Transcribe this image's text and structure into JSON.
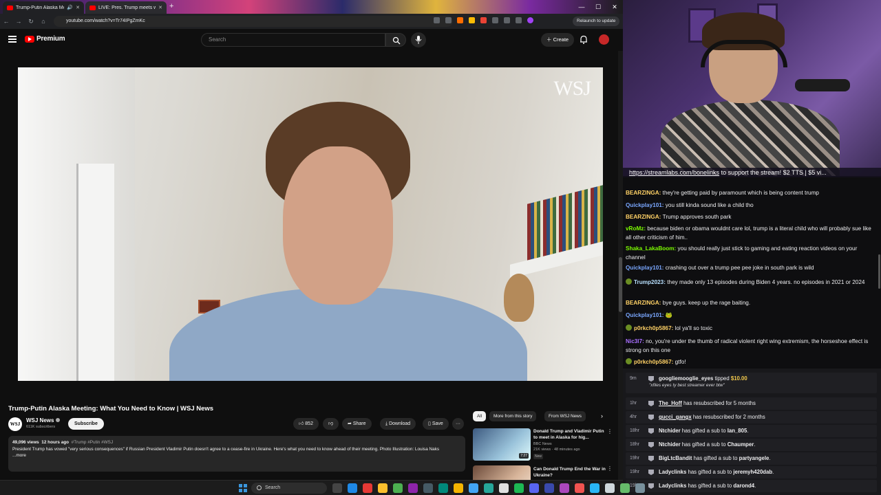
{
  "browser": {
    "tabs": [
      {
        "title": "Trump-Putin Alaska Meetin",
        "active": true
      },
      {
        "title": "LIVE: Pres. Trump meets with P",
        "active": false
      }
    ],
    "url": "youtube.com/watch?v=Tr74IPgZmKc",
    "relaunch_label": "Relaunch to update"
  },
  "youtube": {
    "logo_text": "Premium",
    "search_placeholder": "Search",
    "create_label": "Create",
    "video": {
      "watermark": "WSJ",
      "title": "Trump-Putin Alaska Meeting: What You Need to Know | WSJ News",
      "channel": "WSJ News",
      "channel_avatar_text": "WSJ",
      "subscribers": "611K subscribers",
      "subscribe_label": "Subscribe",
      "likes": "852",
      "share_label": "Share",
      "download_label": "Download",
      "save_label": "Save",
      "more_label": "···",
      "views": "49,096 views",
      "age": "12 hours ago",
      "hashtags": "#Trump #Putin #WSJ",
      "description": "President Trump has vowed \"very serious consequences\" if Russian President Vladimir Putin doesn't agree to a cease-fire in Ukraine. Here's what you need to know ahead of their meeting. Photo Illustration: Louisa Naks",
      "more_link": "...more"
    },
    "chips": [
      "All",
      "More from this story",
      "From WSJ News"
    ],
    "recommendations": [
      {
        "title": "Donald Trump and Vladimir Putin to meet in Alaska for hig...",
        "channel": "BBC News",
        "meta": "21K views · 48 minutes ago",
        "badge": "New",
        "duration": "7:27"
      },
      {
        "title": "Can Donald Trump End the War in Ukraine?",
        "channel": "",
        "meta": "",
        "badge": "",
        "duration": ""
      }
    ]
  },
  "stream": {
    "ticker_link": "https://streamlabs.com/bonelinks",
    "ticker_text": " to support the stream! $2 TTS | $5 vi...",
    "chat": [
      {
        "user": "BEARZINGA",
        "color": "#ffd166",
        "text": "they're getting paid by paramount which is being content trump",
        "badge": false
      },
      {
        "user": "Quickplay101",
        "color": "#7aa7ff",
        "text": "you still kinda sound like a child tho",
        "badge": false
      },
      {
        "user": "BEARZINGA",
        "color": "#ffd166",
        "text": "Trump approves south park",
        "badge": false
      },
      {
        "user": "vRoMz",
        "color": "#7cfc00",
        "text": "because biden or obama wouldnt care lol, trump is a literal child who will probably sue like all other criticism of him..",
        "badge": false
      },
      {
        "user": "Shaka_LakaBoom",
        "color": "#7cfc00",
        "text": "you should really just stick to gaming and eating reaction videos on your channel",
        "badge": false
      },
      {
        "user": "Quickplay101",
        "color": "#7aa7ff",
        "text": "crashing out over a trump pee pee joke in south park is wild",
        "badge": false
      },
      {
        "user": "Trump2023",
        "color": "#b8e0ff",
        "text": "they made only 13 episodes during Biden 4 years. no episodes in 2021 or 2024",
        "badge": true
      },
      {
        "user": "BEARZINGA",
        "color": "#ffd166",
        "text": "bye guys. keep up the rage baiting.",
        "badge": false
      },
      {
        "user": "Quickplay101",
        "color": "#7aa7ff",
        "text": "🐸",
        "badge": false
      },
      {
        "user": "p0rkch0p5867",
        "color": "#ffd166",
        "text": "lol ya'll so toxic",
        "badge": true
      },
      {
        "user": "Nic3l7",
        "color": "#a970ff",
        "text": "no, you're under the thumb of radical violent right wing extremism, the horseshoe effect is strong on this one",
        "badge": false
      },
      {
        "user": "p0rkch0p5867",
        "color": "#ffd166",
        "text": "gtfo!",
        "badge": true
      }
    ],
    "events": [
      {
        "time": "9m",
        "user": "googliemooglie_eyes",
        "action": "tipped",
        "target": "$10.00",
        "note": "\"xfiles eyes ty best streamer ever btw\"",
        "type": "tip"
      },
      {
        "time": "1hr",
        "user": "The_Hoff",
        "action": "has resubscribed for 5 months",
        "target": "",
        "type": "resub"
      },
      {
        "time": "4hr",
        "user": "gucci_gangx",
        "action": "has resubscribed for 2 months",
        "target": "",
        "type": "resub"
      },
      {
        "time": "18hr",
        "user": "Ntchider",
        "action": "has gifted a sub to",
        "target": "Ian_805",
        "type": "gift"
      },
      {
        "time": "18hr",
        "user": "Ntchider",
        "action": "has gifted a sub to",
        "target": "Chaumper",
        "type": "gift"
      },
      {
        "time": "19hr",
        "user": "BigLtcBandit",
        "action": "has gifted a sub to",
        "target": "partyangele",
        "type": "gift"
      },
      {
        "time": "19hr",
        "user": "Ladyclinks",
        "action": "has gifted a sub to",
        "target": "jeremyh420dab",
        "type": "gift"
      },
      {
        "time": "19hr",
        "user": "Ladyclinks",
        "action": "has gifted a sub to",
        "target": "darond4",
        "type": "gift"
      }
    ]
  },
  "taskbar": {
    "search_label": "Search",
    "app_colors": [
      "#444",
      "#1e88e5",
      "#e53935",
      "#fbc02d",
      "#4caf50",
      "#8e24aa",
      "#455a64",
      "#00897b",
      "#f4b400",
      "#42a5f5",
      "#26a69a",
      "#e0e0e0",
      "#1db954",
      "#5865f2",
      "#3949ab",
      "#ab47bc",
      "#ef5350",
      "#29b6f6",
      "#cfd8dc",
      "#66bb6a",
      "#78909c"
    ]
  }
}
